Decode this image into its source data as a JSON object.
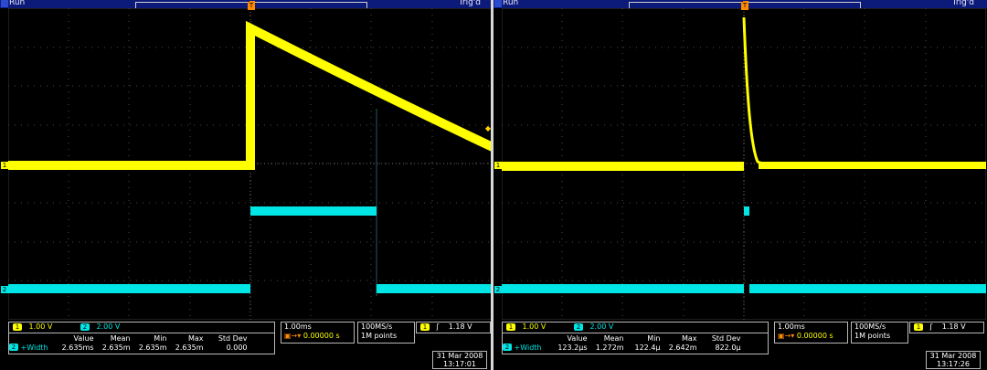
{
  "colors": {
    "ch1": "#ffff00",
    "ch2": "#00e5e5",
    "trigger": "#ff8a00",
    "grid": "#505050"
  },
  "scopes": [
    {
      "status": "Run",
      "trig_status": "Trig'd",
      "ch1_scale": "1.00 V",
      "ch2_scale": "2.00 V",
      "timebase": "1.00ms",
      "delay": "0.00000 s",
      "sample_rate": "100MS/s",
      "record_length": "1M points",
      "trigger_level": "1.18 V",
      "trigger_channel": "1",
      "ch1_label": "1",
      "ch2_label": "2",
      "measure": {
        "headers": [
          "Value",
          "Mean",
          "Min",
          "Max",
          "Std Dev"
        ],
        "label": "+Width",
        "values": [
          "2.635ms",
          "2.635m",
          "2.635m",
          "2.635m",
          "0.000"
        ]
      },
      "date": "31 Mar 2008",
      "time": "13:17:01"
    },
    {
      "status": "Run",
      "trig_status": "Trig'd",
      "ch1_scale": "1.00 V",
      "ch2_scale": "2.00 V",
      "timebase": "1.00ms",
      "delay": "0.00000 s",
      "sample_rate": "100MS/s",
      "record_length": "1M points",
      "trigger_level": "1.18 V",
      "trigger_channel": "1",
      "ch1_label": "1",
      "ch2_label": "2",
      "measure": {
        "headers": [
          "Value",
          "Mean",
          "Min",
          "Max",
          "Std Dev"
        ],
        "label": "+Width",
        "values": [
          "123.2µs",
          "1.272m",
          "122.4µ",
          "2.642m",
          "822.0µ"
        ]
      },
      "date": "31 Mar 2008",
      "time": "13:17:26"
    }
  ]
}
